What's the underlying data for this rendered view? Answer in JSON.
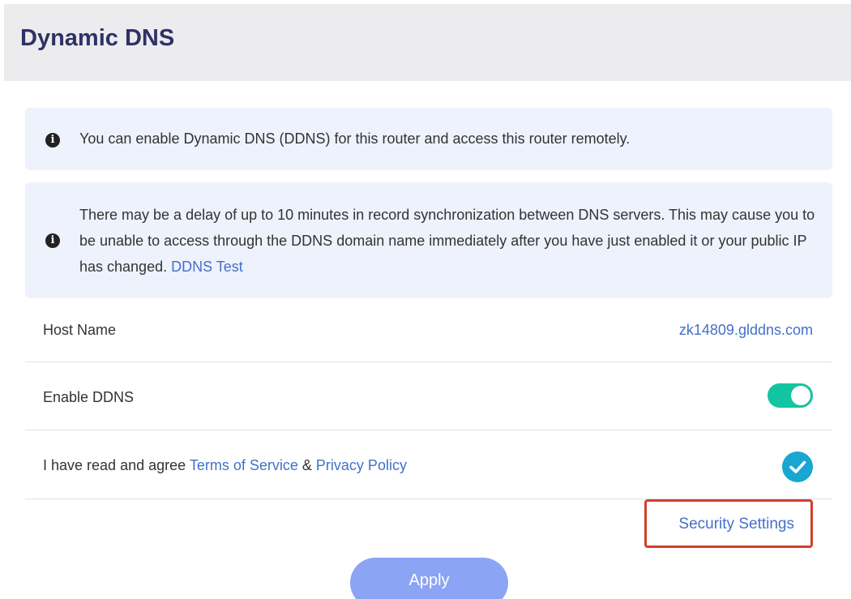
{
  "header": {
    "title": "Dynamic DNS"
  },
  "notices": [
    {
      "icon": "info-icon",
      "text": "You can enable Dynamic DNS (DDNS) for this router and access this router remotely."
    },
    {
      "icon": "info-icon",
      "text": "There may be a delay of up to 10 minutes in record synchronization between DNS servers. This may cause you to be unable to access through the DDNS domain name immediately after you have just enabled it or your public IP has changed.",
      "link_label": "DDNS Test"
    }
  ],
  "host": {
    "label": "Host Name",
    "value": "zk14809.glddns.com"
  },
  "ddns": {
    "label": "Enable DDNS",
    "enabled": true
  },
  "terms": {
    "prefix": "I have read and agree",
    "tos_label": "Terms of Service",
    "separator": "&",
    "privacy_label": "Privacy Policy",
    "checked": true
  },
  "security": {
    "label": "Security Settings"
  },
  "apply": {
    "label": "Apply"
  },
  "colors": {
    "header_bg": "#ececef",
    "title": "#2f3266",
    "notice_bg": "#eef2fd",
    "link": "#4470c8",
    "toggle_on": "#13c4a0",
    "check": "#18a6d2",
    "highlight_border": "#d2402a",
    "apply_bg": "#8ca4f4"
  }
}
